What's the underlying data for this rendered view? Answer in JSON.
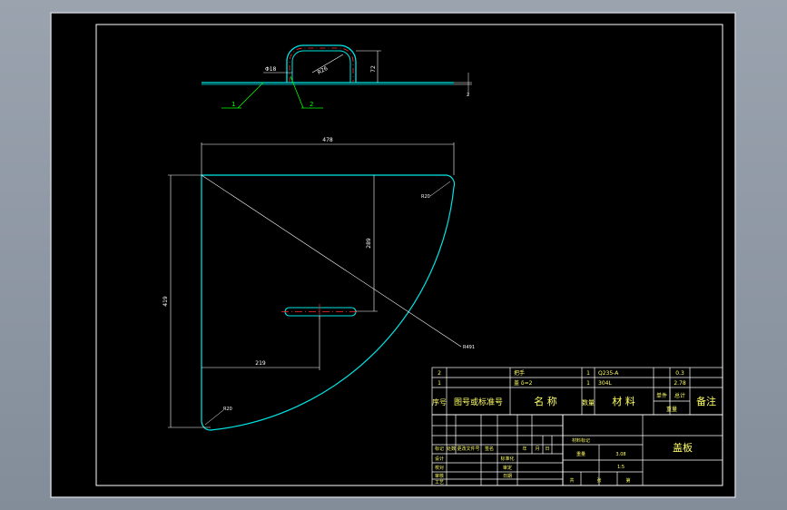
{
  "colors": {
    "canvas": "#000000",
    "border": "#ffffff",
    "part": "#00e5e5",
    "dimension": "#ffffff",
    "centerline": "#ff2a2a",
    "leader": "#00ff00",
    "titleblock_line": "#ffffff",
    "titleblock_text": "#ffff66"
  },
  "top_view": {
    "dim_diameter": "Φ18",
    "dim_radius": "R26",
    "dim_height": "72",
    "dim_thickness": "2",
    "balloon_1": "1",
    "balloon_2": "2"
  },
  "plan_view": {
    "dim_width": "478",
    "dim_height": "419",
    "dim_inner_height": "289",
    "dim_offset": "219",
    "dim_corner_tr": "R20",
    "dim_corner_bl": "R20",
    "dim_arc": "R491"
  },
  "title_block": {
    "bom_rows": [
      {
        "index": "2",
        "code": "",
        "name": "把手",
        "qty": "1",
        "material": "Q235-A",
        "unit_weight": "",
        "total_weight": "0.3",
        "note": ""
      },
      {
        "index": "1",
        "code": "",
        "name": "盖 δ=2",
        "qty": "1",
        "material": "304L",
        "unit_weight": "",
        "total_weight": "2.78",
        "note": ""
      }
    ],
    "header": {
      "index": "序号",
      "code": "图号或标准号",
      "name": "名  称",
      "qty": "数量",
      "material": "材  料",
      "unit": "单件",
      "total": "总计",
      "weight": "重量",
      "note": "备注"
    },
    "rev_headers": [
      "标记",
      "处数",
      "更改文件号",
      "签名",
      "年",
      "月",
      "日"
    ],
    "roles": [
      "设计",
      "校对",
      "审核",
      "工艺"
    ],
    "roles_right": [
      "标准化",
      "审定",
      "日期"
    ],
    "material_mark": "材料标记",
    "weight_label": "重量",
    "weight_value": "3.08",
    "scale_label": "1:5",
    "sheet_prefix": "共",
    "sheet_of": "张",
    "sheet_no": "第",
    "drawing_title": "盖板"
  }
}
